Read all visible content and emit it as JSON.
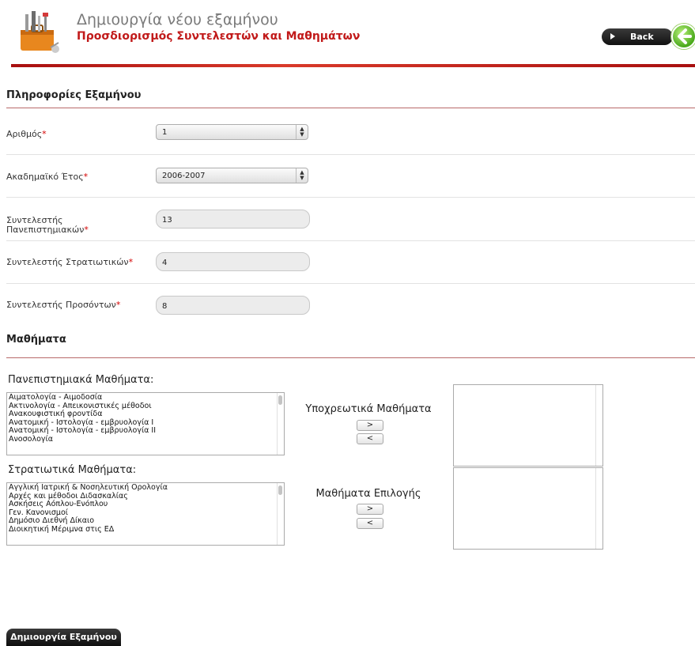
{
  "header": {
    "title": "Δημιουργία νέου εξαμήνου",
    "subtitle": "Προσδιορισμός Συντελεστών και Μαθημάτων",
    "back_label": "Back"
  },
  "info_section": {
    "title": "Πληροφορίες Εξαμήνου",
    "fields": {
      "number": {
        "label": "Αριθμός",
        "value": "1"
      },
      "year": {
        "label": "Ακαδημαϊκό Έτος",
        "value": "2006-2007"
      },
      "uni_coef": {
        "label_line1": "Συντελεστής",
        "label_line2": "Πανεπιστημιακών",
        "value": "13"
      },
      "mil_coef": {
        "label": "Συντελεστής Στρατιωτικών",
        "value": "4"
      },
      "qual_coef": {
        "label": "Συντελεστής Προσόντων",
        "value": "8"
      }
    },
    "required_mark": "*"
  },
  "courses_section": {
    "title": "Μαθήματα",
    "university": {
      "title": "Πανεπιστημιακά Μαθήματα:",
      "items": [
        "Αιματολογία - Αιμοδοσία",
        "Ακτινολογία - Απεικονιστικές μέθοδοι",
        "Ανακουφιστική φροντίδα",
        "Ανατομική - Ιστολογία - εμβρυολογία Ι",
        "Ανατομική - Ιστολογία - εμβρυολογία ΙΙ",
        "Ανοσολογία"
      ]
    },
    "military": {
      "title": "Στρατιωτικά Μαθήματα:",
      "items": [
        "Αγγλική Ιατρική & Νοσηλευτική Ορολογία",
        "Αρχές και μέθοδοι Διδασκαλίας",
        "Ασκήσεις Αόπλου-Ενόπλου",
        "Γεν. Κανονισμοί",
        "Δημόσιο Διεθνή Δίκαιο",
        "Διοικητική Μέριμνα στις ΕΔ"
      ]
    },
    "mandatory_title": "Υποχρεωτικά Μαθήματα",
    "elective_title": "Μαθήματα Επιλογής",
    "add_label": ">",
    "remove_label": "<"
  },
  "create_button": "Δημιουργία Εξαμήνου"
}
